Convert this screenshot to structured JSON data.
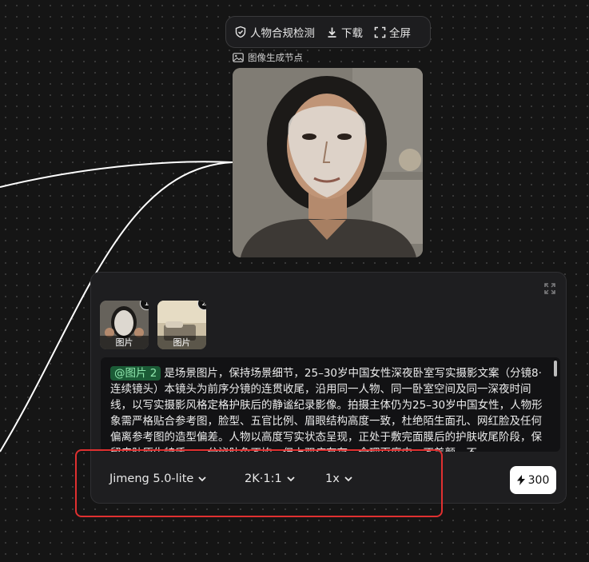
{
  "toolbar": {
    "compliance_label": "人物合规检测",
    "download_label": "下载",
    "fullscreen_label": "全屏"
  },
  "node": {
    "title": "图像生成节点"
  },
  "panel": {
    "references": [
      {
        "number": "1",
        "caption": "图片"
      },
      {
        "number": "2",
        "caption": "图片"
      }
    ],
    "prompt": {
      "mention": "@图片 2",
      "text": "是场景图片，保持场景细节，25–30岁中国女性深夜卧室写实摄影文案（分镜8·连续镜头）本镜头为前序分镜的连贯收尾，沿用同一人物、同一卧室空间及同一深夜时间线，以写实摄影风格定格护肤后的静谧纪录影像。拍摄主体仍为25–30岁中国女性，人物形象需严格贴合参考图，脸型、五官比例、眉眼结构高度一致，杜绝陌生面孔、网红脸及任何偏离参考图的造型偏差。人物以高度写实状态呈现，正处于敷完面膜后的护肤收尾阶段，保留皮肤原生特质，一分泌肤色不均，但上双痘有存一全理百度内一不美颜一不"
    },
    "controls": {
      "model": "Jimeng 5.0-lite",
      "resolution": "2K·1:1",
      "count": "1x",
      "cost": "300"
    }
  },
  "colors": {
    "highlight_border": "#e03030",
    "mention_bg": "#1b5b36",
    "mention_text": "#8fe6ad"
  }
}
